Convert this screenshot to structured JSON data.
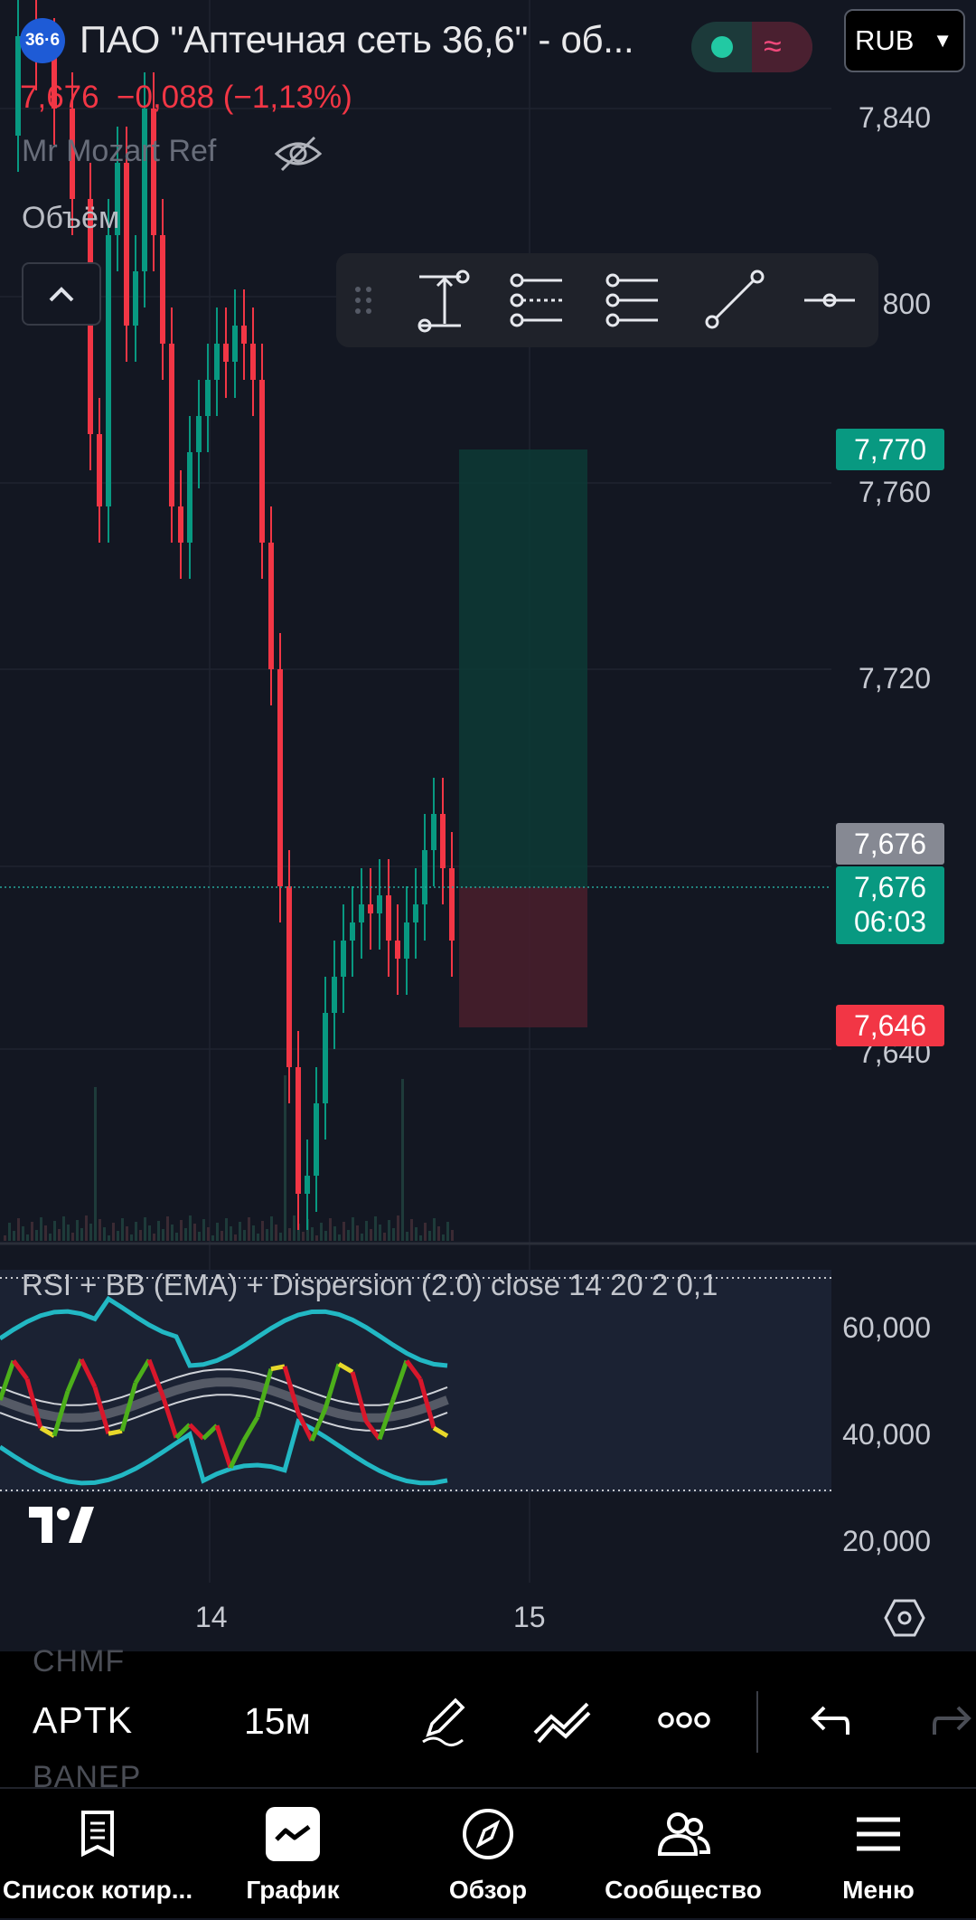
{
  "header": {
    "logo_text": "36·6",
    "title": "ПАО \"Аптечная сеть 36,6\" - об...",
    "currency": "RUB",
    "last_price": "7,676",
    "change": "−0,088 (−1,13%)"
  },
  "overlays": {
    "indicator_name": "Mr Mozart Ref",
    "volume_label": "Объём"
  },
  "price_axis": {
    "labels": [
      "7,840",
      "800",
      "7,760",
      "7,720",
      "7,640"
    ],
    "tags": {
      "target": "7,770",
      "last_gray": "7,676",
      "last_green": "7,676",
      "countdown": "06:03",
      "stop": "7,646"
    },
    "tag_colors": {
      "target": "#089981",
      "last_gray": "#868993",
      "last_green": "#089981",
      "stop": "#f23645"
    }
  },
  "rsi_pane": {
    "label": "RSI + BB (EMA) + Dispersion (2.0) close 14 20 2 0,1",
    "axis": [
      "60,000",
      "40,000",
      "20,000"
    ]
  },
  "time_axis": [
    "14",
    "15"
  ],
  "symbol_toolbar": {
    "prev_symbol": "CHMF",
    "symbol": "APTK",
    "next_symbol": "BANEP",
    "interval": "15м"
  },
  "bottom_nav": [
    {
      "label": "Список котир...",
      "icon": "list-icon"
    },
    {
      "label": "График",
      "icon": "chart-icon"
    },
    {
      "label": "Обзор",
      "icon": "compass-icon"
    },
    {
      "label": "Сообщество",
      "icon": "community-icon"
    },
    {
      "label": "Меню",
      "icon": "menu-icon"
    }
  ],
  "chart_data": {
    "type": "candlestick",
    "symbol": "APTK",
    "interval": "15м",
    "ylim": [
      7.62,
      7.85
    ],
    "x_ticks": [
      "14",
      "15"
    ],
    "position": {
      "entry": 7.676,
      "target": 7.77,
      "stop": 7.646
    },
    "rsi_ylim": [
      10,
      70
    ],
    "rsi_levels": [
      60,
      40,
      20
    ],
    "colors": {
      "up": "#089981",
      "down": "#f23645",
      "rsi_band": "#22b8c4"
    }
  }
}
